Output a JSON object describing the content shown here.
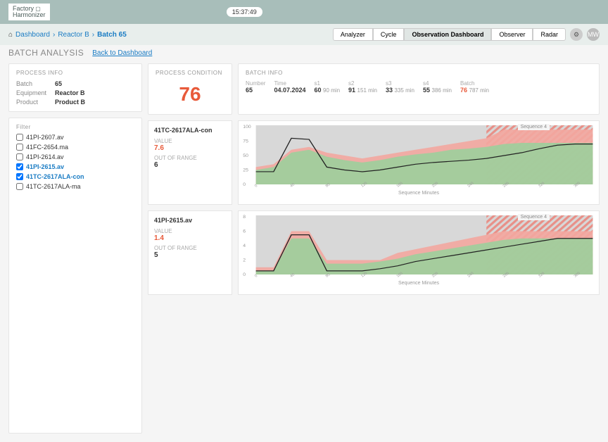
{
  "header": {
    "logo_line1": "Factory",
    "logo_line2": "Harmonizer",
    "time": "15:37:49"
  },
  "breadcrumb": {
    "items": [
      "Dashboard",
      "Reactor B",
      "Batch 65"
    ]
  },
  "tabs": {
    "items": [
      "Analyzer",
      "Cycle",
      "Observation Dashboard",
      "Observer",
      "Radar"
    ],
    "active_index": 2
  },
  "avatar_initials": "MW",
  "subhead": {
    "title": "BATCH ANALYSIS",
    "back_link": "Back to Dashboard"
  },
  "process_info": {
    "title": "PROCESS INFO",
    "rows": [
      {
        "k": "Batch",
        "v": "65"
      },
      {
        "k": "Equipment",
        "v": "Reactor B"
      },
      {
        "k": "Product",
        "v": "Product B"
      }
    ]
  },
  "process_condition": {
    "title": "PROCESS CONDITION",
    "value": "76"
  },
  "batch_info": {
    "title": "BATCH INFO",
    "cols": [
      {
        "k": "Number",
        "v": "65"
      },
      {
        "k": "Time",
        "v": "04.07.2024"
      },
      {
        "k": "s1",
        "v": "60",
        "unit": "90 min",
        "hl": false
      },
      {
        "k": "s2",
        "v": "91",
        "unit": "151 min",
        "hl": false
      },
      {
        "k": "s3",
        "v": "33",
        "unit": "335 min",
        "hl": false
      },
      {
        "k": "s4",
        "v": "55",
        "unit": "386 min",
        "hl": false
      },
      {
        "k": "Batch",
        "v": "76",
        "unit": "787 min",
        "hl": true
      }
    ]
  },
  "filter": {
    "title": "Filter",
    "items": [
      {
        "label": "41PI-2607.av",
        "checked": false
      },
      {
        "label": "41FC-2654.ma",
        "checked": false
      },
      {
        "label": "41PI-2614.av",
        "checked": false
      },
      {
        "label": "41PI-2615.av",
        "checked": true
      },
      {
        "label": "41TC-2617ALA-con",
        "checked": true
      },
      {
        "label": "41TC-2617ALA-ma",
        "checked": false
      }
    ]
  },
  "charts": [
    {
      "name": "41TC-2617ALA-con",
      "value": "7.6",
      "out_of_range": "6",
      "seq_label": "Sequence 4",
      "xlabel": "Sequence Minutes"
    },
    {
      "name": "41PI-2615.av",
      "value": "1.4",
      "out_of_range": "5",
      "seq_label": "Sequence 4",
      "xlabel": "Sequence Minutes"
    }
  ],
  "meta_labels": {
    "value": "VALUE",
    "out_of_range": "OUT OF RANGE"
  },
  "chart_data": [
    {
      "type": "area",
      "ylim": [
        0,
        100
      ],
      "x": [
        0,
        20,
        40,
        60,
        80,
        100,
        120,
        140,
        160,
        180,
        200,
        220,
        240,
        260,
        280,
        300,
        320,
        340,
        360,
        380
      ],
      "series": [
        {
          "name": "upper",
          "values": [
            30,
            35,
            60,
            65,
            55,
            50,
            45,
            50,
            55,
            60,
            65,
            70,
            75,
            80,
            95,
            95,
            95,
            95,
            95,
            95
          ],
          "fill": "#f3a7a0"
        },
        {
          "name": "mid",
          "values": [
            25,
            30,
            55,
            60,
            48,
            42,
            38,
            42,
            48,
            52,
            55,
            60,
            62,
            65,
            70,
            72,
            72,
            72,
            72,
            72
          ],
          "fill": "#9ccf9c"
        },
        {
          "name": "actual",
          "values": [
            22,
            22,
            80,
            78,
            30,
            25,
            22,
            25,
            30,
            35,
            38,
            40,
            42,
            45,
            50,
            55,
            62,
            68,
            70,
            70
          ],
          "stroke": "#333"
        }
      ]
    },
    {
      "type": "area",
      "ylim": [
        0,
        8
      ],
      "x": [
        0,
        20,
        40,
        60,
        80,
        100,
        120,
        140,
        160,
        180,
        200,
        220,
        240,
        260,
        280,
        300,
        320,
        340,
        360,
        380
      ],
      "series": [
        {
          "name": "upper",
          "values": [
            1,
            1,
            6,
            6,
            2,
            2,
            2,
            2,
            3,
            3.5,
            4,
            4.5,
            5,
            5.5,
            6,
            6,
            6,
            6,
            6,
            6
          ],
          "fill": "#f3a7a0"
        },
        {
          "name": "mid",
          "values": [
            0.5,
            0.5,
            5,
            5,
            1.5,
            1.5,
            1.5,
            1.8,
            2.2,
            2.8,
            3.2,
            3.6,
            4,
            4.4,
            4.8,
            5,
            5,
            5,
            5,
            5
          ],
          "fill": "#9ccf9c"
        },
        {
          "name": "actual",
          "values": [
            0.5,
            0.5,
            5.5,
            5.5,
            0.5,
            0.5,
            0.5,
            0.8,
            1.2,
            1.8,
            2.2,
            2.6,
            3,
            3.4,
            3.8,
            4.2,
            4.6,
            5,
            5,
            5
          ],
          "stroke": "#333"
        }
      ]
    }
  ]
}
